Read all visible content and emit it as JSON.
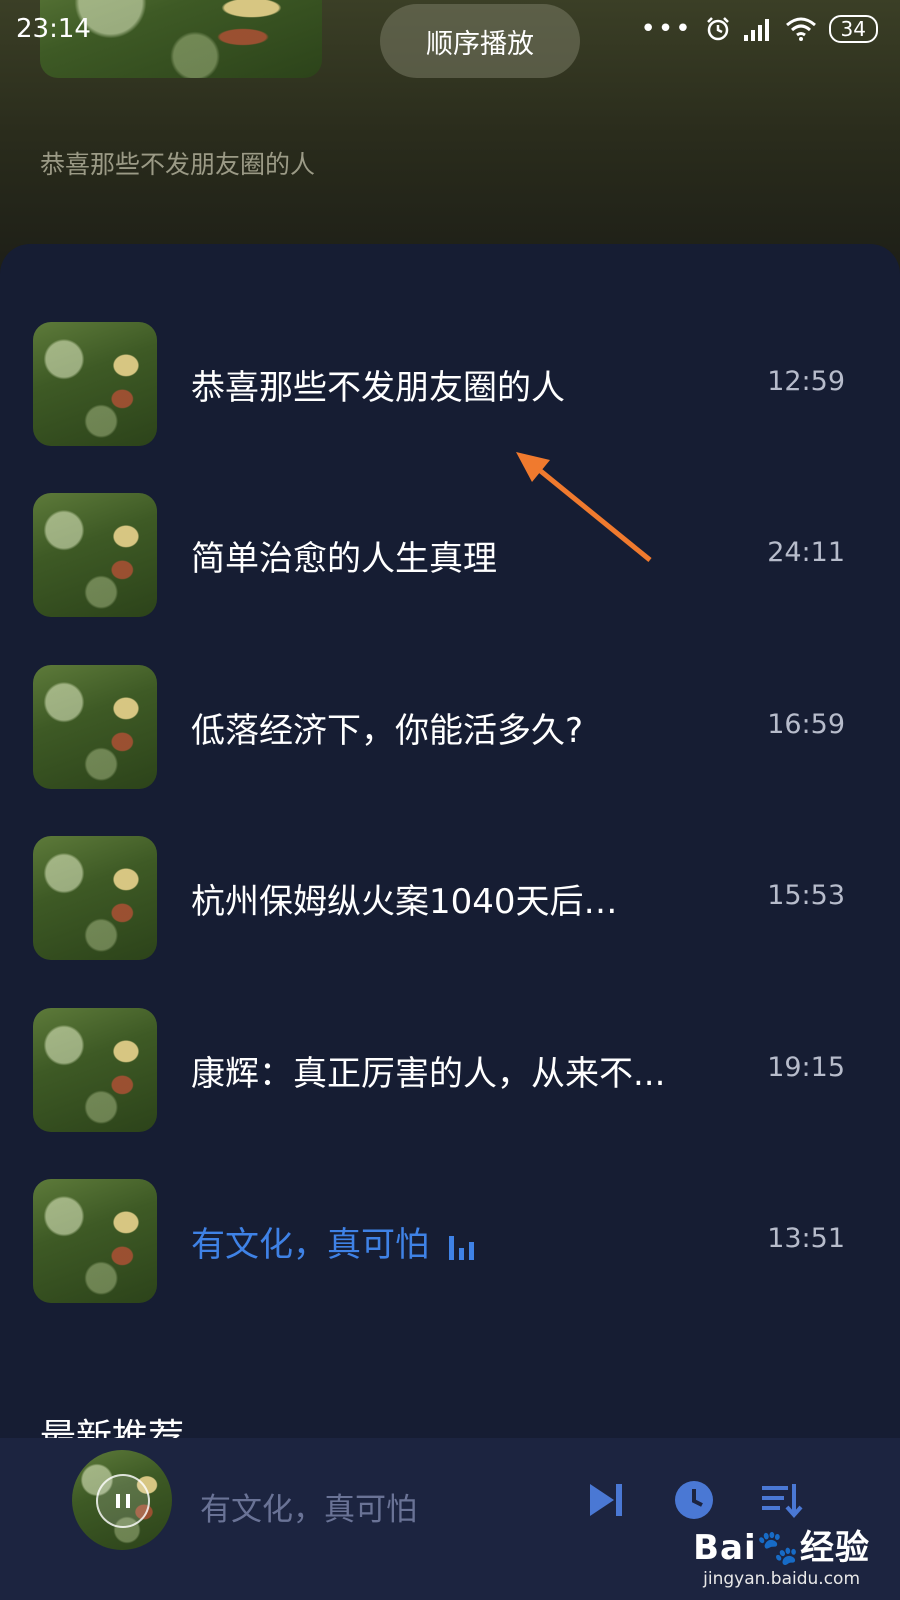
{
  "status_bar": {
    "time": "23:14",
    "battery": "34",
    "signal_icons": [
      "dots-icon",
      "alarm-icon",
      "signal-icon",
      "wifi-icon"
    ]
  },
  "header": {
    "play_mode": "顺序播放",
    "subtitle": "恭喜那些不发朋友圈的人"
  },
  "playlist": [
    {
      "title": "恭喜那些不发朋友圈的人",
      "duration": "12:59"
    },
    {
      "title": "简单治愈的人生真理",
      "duration": "24:11"
    },
    {
      "title": "低落经济下，你能活多久?",
      "duration": "16:59"
    },
    {
      "title": "杭州保姆纵火案1040天后…",
      "duration": "15:53"
    },
    {
      "title": "康辉：真正厉害的人，从来不...",
      "duration": "19:15"
    },
    {
      "title": "有文化，真可怕",
      "duration": "13:51",
      "playing": true
    }
  ],
  "section": {
    "heading": "最新推荐"
  },
  "player": {
    "now_playing": "有文化，真可怕"
  },
  "watermark": {
    "logo_prefix": "Bai",
    "logo_suffix": "经验",
    "url": "jingyan.baidu.com"
  },
  "colors": {
    "accent": "#3f82e6",
    "panel": "#161d33",
    "arrow": "#f07a2e"
  }
}
